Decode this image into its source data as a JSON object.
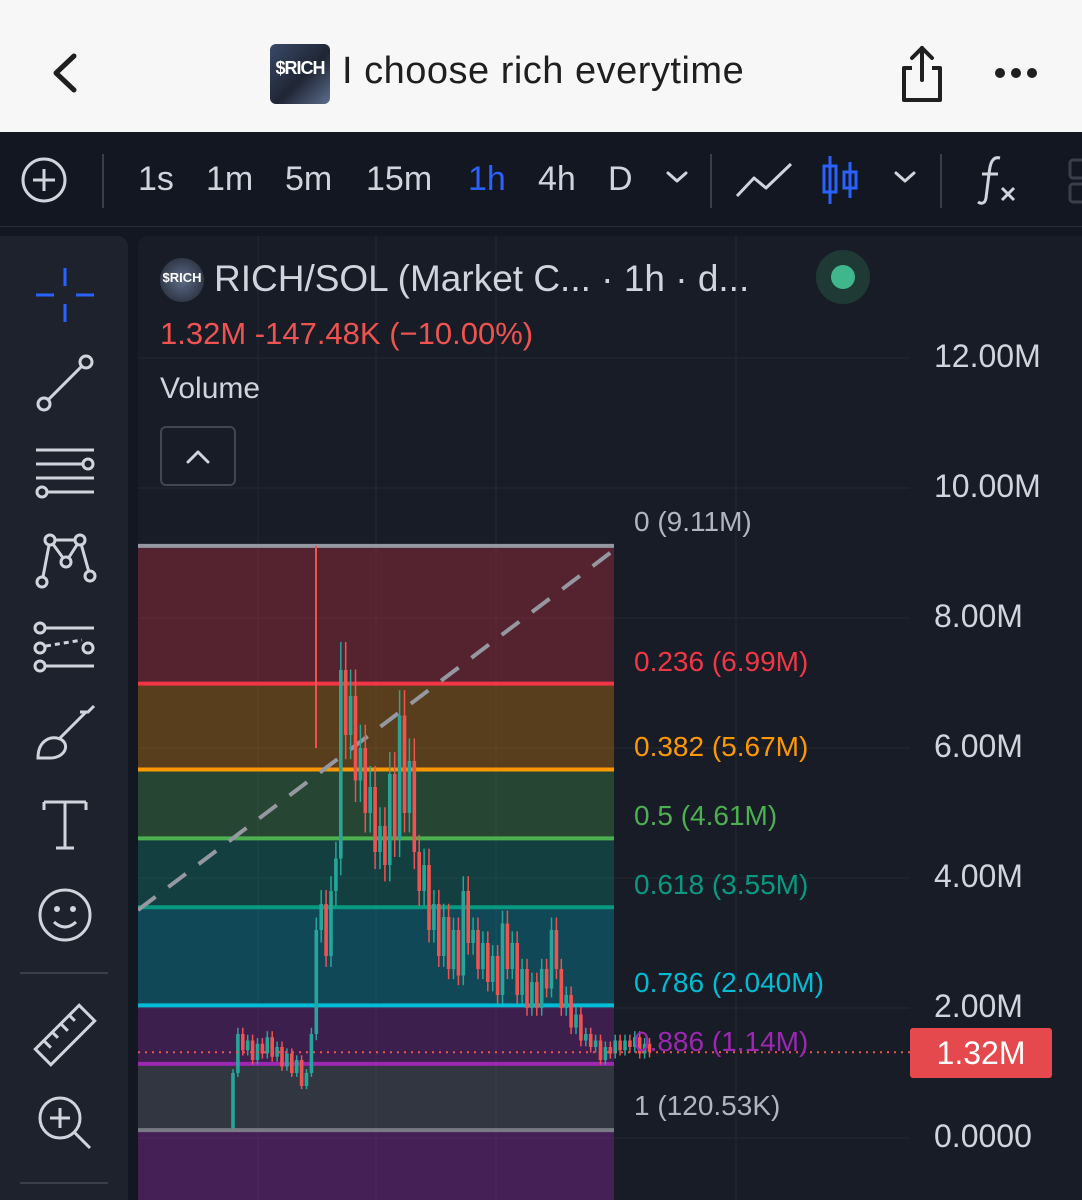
{
  "header": {
    "logo_text": "$RICH",
    "title": "I choose rich everytime"
  },
  "toolbar": {
    "timeframes": [
      "1s",
      "1m",
      "5m",
      "15m",
      "1h",
      "4h",
      "D"
    ],
    "active_timeframe": "1h"
  },
  "chart_panel": {
    "legend_logo_text": "$RICH",
    "symbol": "RICH/SOL (Market C... · 1h · d...",
    "change": "1.32M  -147.48K (−10.00%)",
    "volume_label": "Volume",
    "status_color": "#3fb68b"
  },
  "colors": {
    "background": "#131722",
    "accent": "#2962ff",
    "down": "#ef5350",
    "up": "#26a69a"
  },
  "chart_data": {
    "type": "candlestick",
    "y_axis": {
      "ticks": [
        "12.00M",
        "10.00M",
        "8.00M",
        "6.00M",
        "4.00M",
        "2.00M",
        "0.0000"
      ],
      "ylim": [
        0,
        12000000
      ]
    },
    "last_price": "1.32M",
    "last_price_value": 1320000,
    "fibonacci": [
      {
        "label": "0 (9.11M)",
        "level": 0,
        "value": 9110000,
        "color": "#9598a1"
      },
      {
        "label": "0.236 (6.99M)",
        "level": 0.236,
        "value": 6990000,
        "color": "#f23645"
      },
      {
        "label": "0.382 (5.67M)",
        "level": 0.382,
        "value": 5670000,
        "color": "#ff9800"
      },
      {
        "label": "0.5 (4.61M)",
        "level": 0.5,
        "value": 4610000,
        "color": "#4caf50"
      },
      {
        "label": "0.618 (3.55M)",
        "level": 0.618,
        "value": 3550000,
        "color": "#089981"
      },
      {
        "label": "0.786 (2.040M)",
        "level": 0.786,
        "value": 2040000,
        "color": "#00bcd4"
      },
      {
        "label": "0.886 (1.14M)",
        "level": 0.886,
        "value": 1140000,
        "color": "#9c27b0"
      },
      {
        "label": "1 (120.53K)",
        "level": 1,
        "value": 120530,
        "color": "#787b86"
      }
    ]
  }
}
